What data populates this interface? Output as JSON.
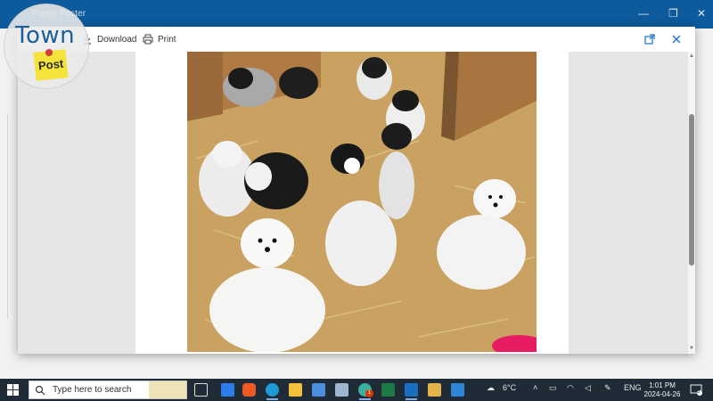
{
  "background_window": {
    "title": "Puppy Poster",
    "controls": [
      "—",
      "❐",
      "✕"
    ]
  },
  "logo": {
    "icon": "town-post-logo-icon",
    "line1": "Town",
    "line2": "Post"
  },
  "dialog_toolbar": {
    "download_label": "Download",
    "print_label": "Print",
    "icons": {
      "download": "download-icon",
      "print": "printer-icon",
      "open": "open-external-icon",
      "close": "close-icon"
    }
  },
  "image": {
    "subject": "puppies-photo",
    "alt": "Puppies"
  },
  "taskbar": {
    "search_placeholder": "Type here to search",
    "weather_temp": "6°C",
    "language": "ENG",
    "time": "1:01 PM",
    "date": "2024-04-26",
    "notification_count": "5",
    "mail_badge": "1",
    "colors": {
      "taskbar_bg": "#1f2c38",
      "title_bar": "#0d5a9c",
      "accent": "#7fb3e6"
    }
  }
}
